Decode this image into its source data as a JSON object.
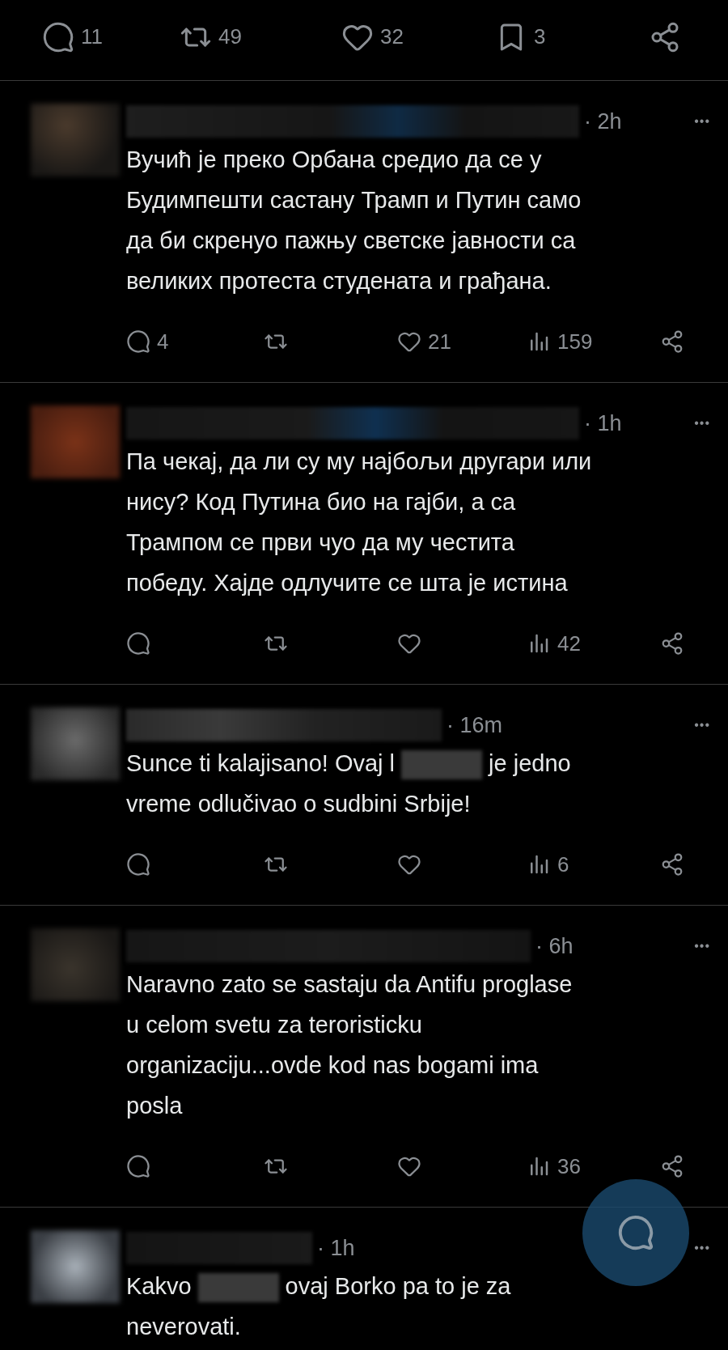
{
  "post_actions": [
    {
      "kind": "reply",
      "count": "11"
    },
    {
      "kind": "repost",
      "count": "49"
    },
    {
      "kind": "like",
      "count": "32"
    },
    {
      "kind": "bookmark",
      "count": "3"
    },
    {
      "kind": "share"
    }
  ],
  "replies": [
    {
      "time": "· 2h",
      "more": "•••",
      "lines": [
        [
          "Вучић је преко Орбана средио да се у"
        ],
        [
          "Будимпешти састану Трамп и Путин само"
        ],
        [
          "да би скренуо пажњу светске јавности са"
        ],
        [
          "великих протеста студената и грађана."
        ]
      ],
      "actions": [
        {
          "kind": "reply",
          "count": "4"
        },
        {
          "kind": "repost"
        },
        {
          "kind": "like",
          "count": "21"
        },
        {
          "kind": "views",
          "count": "159"
        },
        {
          "kind": "share"
        }
      ]
    },
    {
      "time": "· 1h",
      "more": "•••",
      "lines": [
        [
          "Па чекај, да ли су му најбољи другари или"
        ],
        [
          "нису? Код Путина био на гајби, а са"
        ],
        [
          "Трампом се први чуо да му честита"
        ],
        [
          "победу. Хајде одлучите се шта је истина"
        ]
      ],
      "actions": [
        {
          "kind": "reply"
        },
        {
          "kind": "repost"
        },
        {
          "kind": "like"
        },
        {
          "kind": "views",
          "count": "42"
        },
        {
          "kind": "share"
        }
      ]
    },
    {
      "time": "· 16m",
      "more": "•••",
      "lines": [
        [
          "Sunce ti kalajisano! Ovaj l",
          {
            "kind": "redacted"
          },
          "je jedno"
        ],
        [
          "vreme odlučivao o sudbini Srbije!"
        ]
      ],
      "actions": [
        {
          "kind": "reply"
        },
        {
          "kind": "repost"
        },
        {
          "kind": "like"
        },
        {
          "kind": "views",
          "count": "6"
        },
        {
          "kind": "share"
        }
      ]
    },
    {
      "time": "· 6h",
      "more": "•••",
      "lines": [
        [
          "Naravno zato se sastaju da Antifu proglase"
        ],
        [
          "u celom svetu za teroristicku"
        ],
        [
          "organizaciju...ovde kod nas bogami ima"
        ],
        [
          "posla"
        ]
      ],
      "actions": [
        {
          "kind": "reply"
        },
        {
          "kind": "repost"
        },
        {
          "kind": "like"
        },
        {
          "kind": "views",
          "count": "36"
        },
        {
          "kind": "share"
        }
      ]
    },
    {
      "time": "· 1h",
      "more": "•••",
      "lines": [
        [
          "Kakvo",
          {
            "kind": "redacted"
          },
          "ovaj Borko pa to je za"
        ],
        [
          "neverovati."
        ]
      ]
    }
  ]
}
